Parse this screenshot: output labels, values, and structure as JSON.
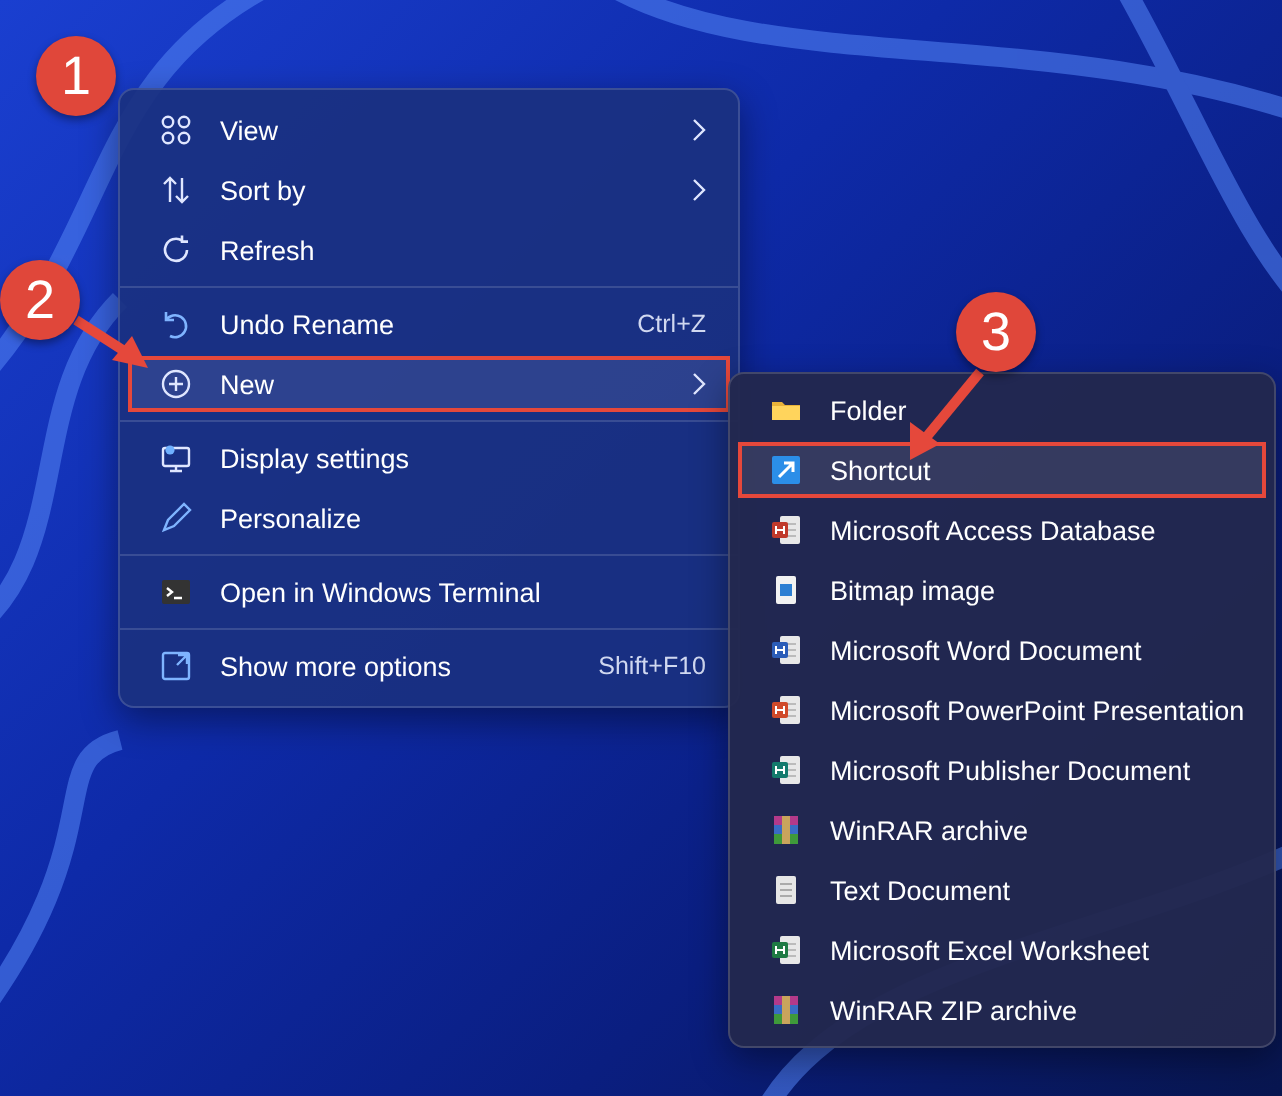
{
  "context_menu": {
    "sections": [
      [
        {
          "label": "View",
          "submenu": true,
          "highlighted": false
        },
        {
          "label": "Sort by",
          "submenu": true,
          "highlighted": false
        },
        {
          "label": "Refresh",
          "submenu": false,
          "highlighted": false
        }
      ],
      [
        {
          "label": "Undo Rename",
          "shortcut": "Ctrl+Z",
          "submenu": false,
          "highlighted": false
        },
        {
          "label": "New",
          "submenu": true,
          "highlighted": true
        }
      ],
      [
        {
          "label": "Display settings",
          "submenu": false,
          "highlighted": false
        },
        {
          "label": "Personalize",
          "submenu": false,
          "highlighted": false
        }
      ],
      [
        {
          "label": "Open in Windows Terminal",
          "submenu": false,
          "highlighted": false
        }
      ],
      [
        {
          "label": "Show more options",
          "shortcut": "Shift+F10",
          "submenu": false,
          "highlighted": false
        }
      ]
    ]
  },
  "new_submenu": {
    "items": [
      {
        "label": "Folder",
        "highlighted": false
      },
      {
        "label": "Shortcut",
        "highlighted": true
      },
      {
        "label": "Microsoft Access Database",
        "highlighted": false
      },
      {
        "label": "Bitmap image",
        "highlighted": false
      },
      {
        "label": "Microsoft Word Document",
        "highlighted": false
      },
      {
        "label": "Microsoft PowerPoint Presentation",
        "highlighted": false
      },
      {
        "label": "Microsoft Publisher Document",
        "highlighted": false
      },
      {
        "label": "WinRAR archive",
        "highlighted": false
      },
      {
        "label": "Text Document",
        "highlighted": false
      },
      {
        "label": "Microsoft Excel Worksheet",
        "highlighted": false
      },
      {
        "label": "WinRAR ZIP archive",
        "highlighted": false
      }
    ]
  },
  "step_badges": [
    {
      "label": "1",
      "arrow": false
    },
    {
      "label": "2",
      "arrow": true
    },
    {
      "label": "3",
      "arrow": true
    }
  ]
}
